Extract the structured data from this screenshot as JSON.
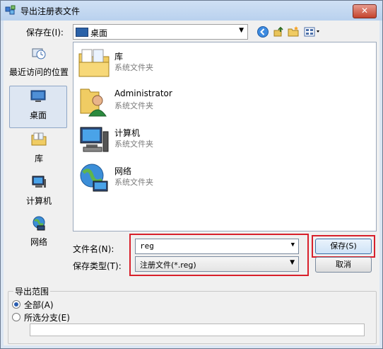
{
  "window": {
    "title": "导出注册表文件",
    "close_glyph": "✕"
  },
  "savein": {
    "label": "保存在(I):",
    "value": "桌面"
  },
  "places": [
    {
      "label": "最近访问的位置"
    },
    {
      "label": "桌面"
    },
    {
      "label": "库"
    },
    {
      "label": "计算机"
    },
    {
      "label": "网络"
    }
  ],
  "files": [
    {
      "name": "库",
      "type": "系统文件夹"
    },
    {
      "name": "Administrator",
      "type": "系统文件夹"
    },
    {
      "name": "计算机",
      "type": "系统文件夹"
    },
    {
      "name": "网络",
      "type": "系统文件夹"
    }
  ],
  "form": {
    "filename_label": "文件名(N):",
    "filename_value": "reg",
    "filetype_label": "保存类型(T):",
    "filetype_value": "注册文件(*.reg)",
    "save_label": "保存(S)",
    "cancel_label": "取消"
  },
  "range": {
    "title": "导出范围",
    "all_label": "全部(A)",
    "branch_label": "所选分支(E)",
    "selected": "all",
    "branch_value": ""
  },
  "colors": {
    "highlight": "#d8202b",
    "title_bar": "#c7daf2"
  }
}
